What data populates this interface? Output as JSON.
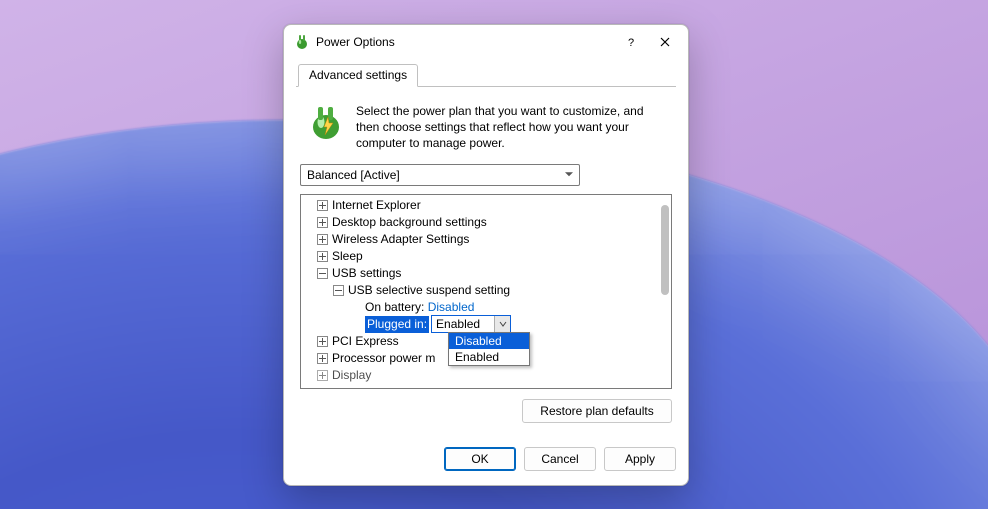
{
  "window": {
    "title": "Power Options",
    "help_tooltip": "?",
    "tab_label": "Advanced settings",
    "intro": "Select the power plan that you want to customize, and then choose settings that reflect how you want your computer to manage power.",
    "plan_selected": "Balanced [Active]"
  },
  "tree": {
    "items": [
      "Internet Explorer",
      "Desktop background settings",
      "Wireless Adapter Settings",
      "Sleep",
      "USB settings",
      "USB selective suspend setting",
      "PCI Express",
      "Processor power m",
      "Display"
    ],
    "on_battery_label": "On battery:",
    "on_battery_value": "Disabled",
    "plugged_in_label": "Plugged in:",
    "plugged_in_value": "Enabled",
    "dropdown_options": [
      "Disabled",
      "Enabled"
    ],
    "dropdown_highlight": "Disabled"
  },
  "buttons": {
    "restore": "Restore plan defaults",
    "ok": "OK",
    "cancel": "Cancel",
    "apply": "Apply"
  }
}
